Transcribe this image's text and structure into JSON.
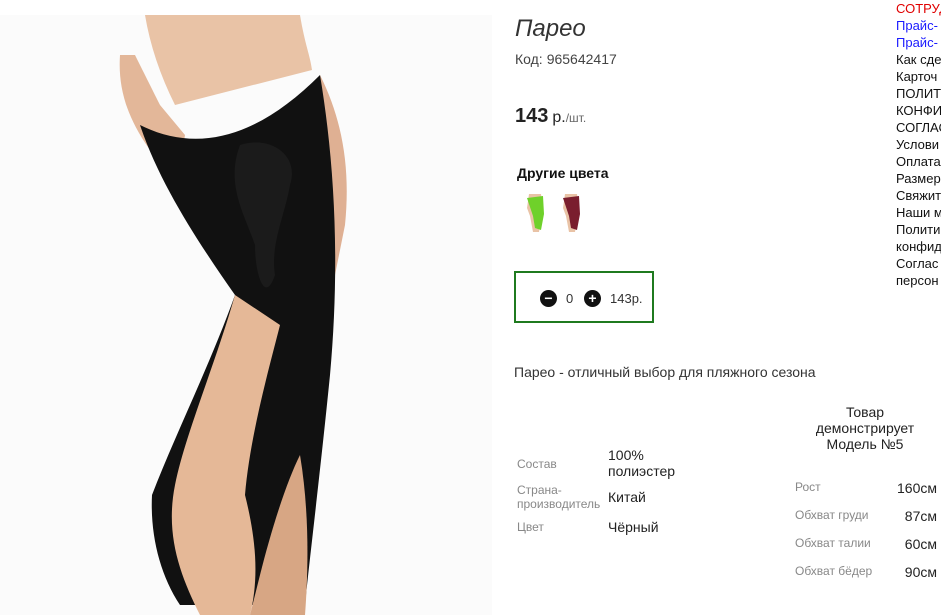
{
  "product": {
    "title": "Парео",
    "code_label": "Код:",
    "code_value": "965642417",
    "price": "143",
    "currency": "р.",
    "unit": "/шт.",
    "other_colors_label": "Другие цвета",
    "description": "Парео - отличный выбор для пляжного сезона"
  },
  "colors": {
    "main_garment": "#111111",
    "swatch_green": "#6fd12a",
    "swatch_maroon": "#7a1e2e",
    "accent_border": "#1f7a1f"
  },
  "quantity": {
    "minus_icon": "minus-circle-icon",
    "plus_icon": "plus-circle-icon",
    "value": "0",
    "sum": "143р."
  },
  "specs": [
    {
      "label": "Состав",
      "value": "100% полиэстер"
    },
    {
      "label": "Страна-производитель",
      "value": "Китай"
    },
    {
      "label": "Цвет",
      "value": "Чёрный"
    }
  ],
  "model": {
    "heading_line1": "Товар",
    "heading_line2": "демонстрирует",
    "heading_line3": "Модель №5",
    "rows": [
      {
        "label": "Рост",
        "value": "160см"
      },
      {
        "label": "Обхват груди",
        "value": "87см"
      },
      {
        "label": "Обхват талии",
        "value": "60см"
      },
      {
        "label": "Обхват бёдер",
        "value": "90см"
      }
    ]
  },
  "side_links": [
    "СОТРУД",
    "Прайс-",
    "Прайс-",
    "Как сде",
    "Карточ",
    "ПОЛИТ",
    "КОНФИ",
    "СОГЛАС",
    "Услови",
    "Оплата",
    "Размер",
    "Свяжит",
    "Наши м",
    "Полити",
    "конфид",
    "Соглас",
    "персон"
  ]
}
